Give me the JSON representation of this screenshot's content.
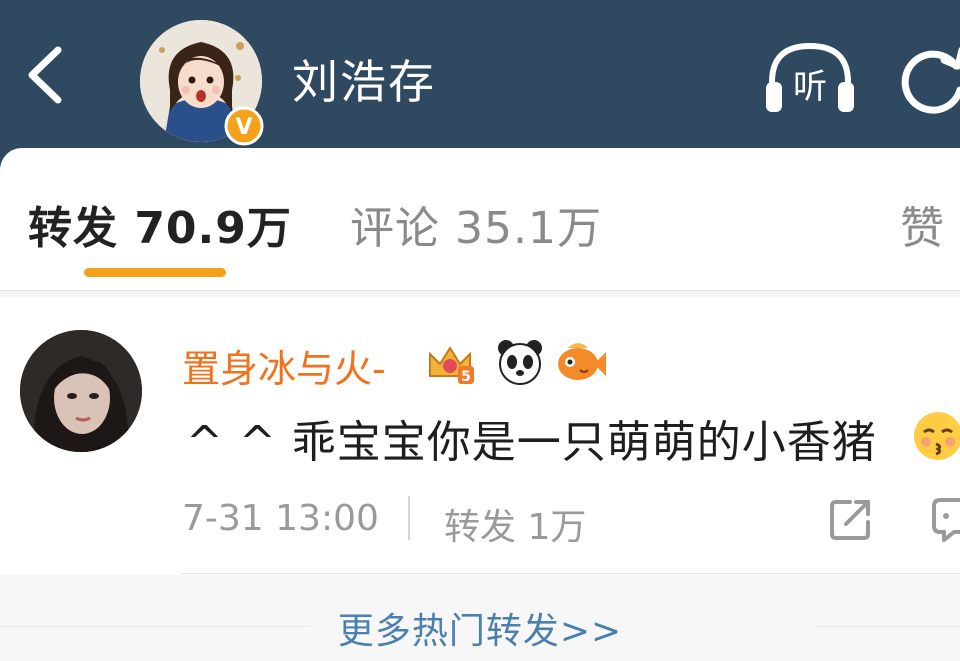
{
  "header": {
    "back_icon": "chevron-left-icon",
    "name": "刘浩存",
    "verified_badge": "V",
    "listen_label": "听",
    "refresh_icon": "refresh-icon",
    "background": "#2f4a60"
  },
  "tabs": [
    {
      "label": "转发 70.9万",
      "active": true
    },
    {
      "label": "评论 35.1万",
      "active": false
    },
    {
      "label": "赞",
      "active": false
    }
  ],
  "colors": {
    "accent_underline": "#f4a21c",
    "username": "#f2711c",
    "link": "#4a7fb0"
  },
  "repost": {
    "username": "置身冰与火-",
    "badges": [
      "crown-level-5-badge",
      "panda-badge",
      "fish-badge"
    ],
    "text": "^ ^ 乖宝宝你是一只萌萌的小香猪",
    "emoji": "kissing-face-emoji",
    "time": "7-31 13:00",
    "repost_count": "转发 1万"
  },
  "footer": {
    "more_link": "更多热门转发>>"
  }
}
